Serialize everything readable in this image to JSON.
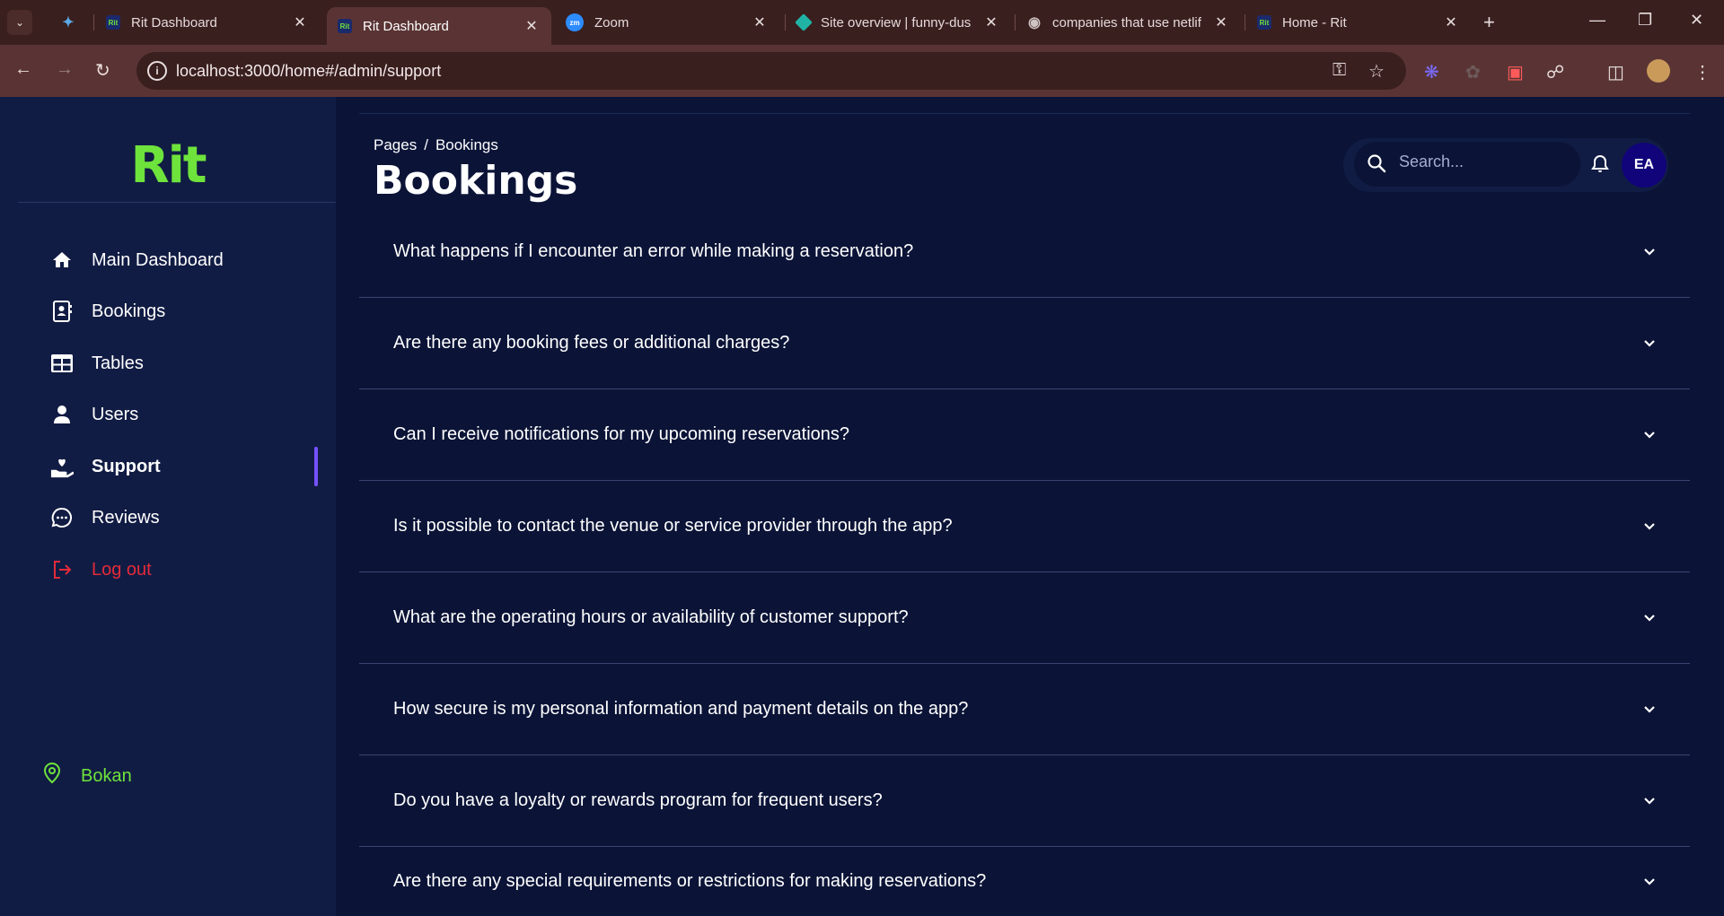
{
  "browser": {
    "tabs": [
      {
        "title": "",
        "favicon": "feather"
      },
      {
        "title": "Rit Dashboard",
        "favicon": "Rit"
      },
      {
        "title": "Rit Dashboard",
        "favicon": "Rit"
      },
      {
        "title": "Zoom",
        "favicon": "zm"
      },
      {
        "title": "Site overview | funny-dus",
        "favicon": "netlify"
      },
      {
        "title": "companies that use netlif",
        "favicon": "globe"
      },
      {
        "title": "Home - Rit",
        "favicon": "Rit"
      }
    ],
    "url": "localhost:3000/home#/admin/support"
  },
  "sidebar": {
    "logo": "Rit",
    "items": [
      {
        "label": "Main Dashboard",
        "icon": "home-icon"
      },
      {
        "label": "Bookings",
        "icon": "contact-book-icon"
      },
      {
        "label": "Tables",
        "icon": "table-icon"
      },
      {
        "label": "Users",
        "icon": "user-icon"
      },
      {
        "label": "Support",
        "icon": "hand-heart-icon"
      },
      {
        "label": "Reviews",
        "icon": "chat-bubble-icon"
      },
      {
        "label": "Log out",
        "icon": "logout-icon"
      }
    ],
    "location": "Bokan"
  },
  "header": {
    "breadcrumb_root": "Pages",
    "breadcrumb_sep": "/",
    "breadcrumb_current": "Bookings",
    "title": "Bookings",
    "search_placeholder": "Search...",
    "avatar_initials": "EA"
  },
  "faqs": [
    "What happens if I encounter an error while making a reservation?",
    "Are there any booking fees or additional charges?",
    "Can I receive notifications for my upcoming reservations?",
    "Is it possible to contact the venue or service provider through the app?",
    "What are the operating hours or availability of customer support?",
    "How secure is my personal information and payment details on the app?",
    "Do you have a loyalty or rewards program for frequent users?",
    "Are there any special requirements or restrictions for making reservations?"
  ],
  "colors": {
    "accent": "#7551ff",
    "brand_green": "#6ee33c",
    "logout_red": "#e32b3a",
    "background": "#0b1437",
    "sidebar": "#111c44"
  }
}
